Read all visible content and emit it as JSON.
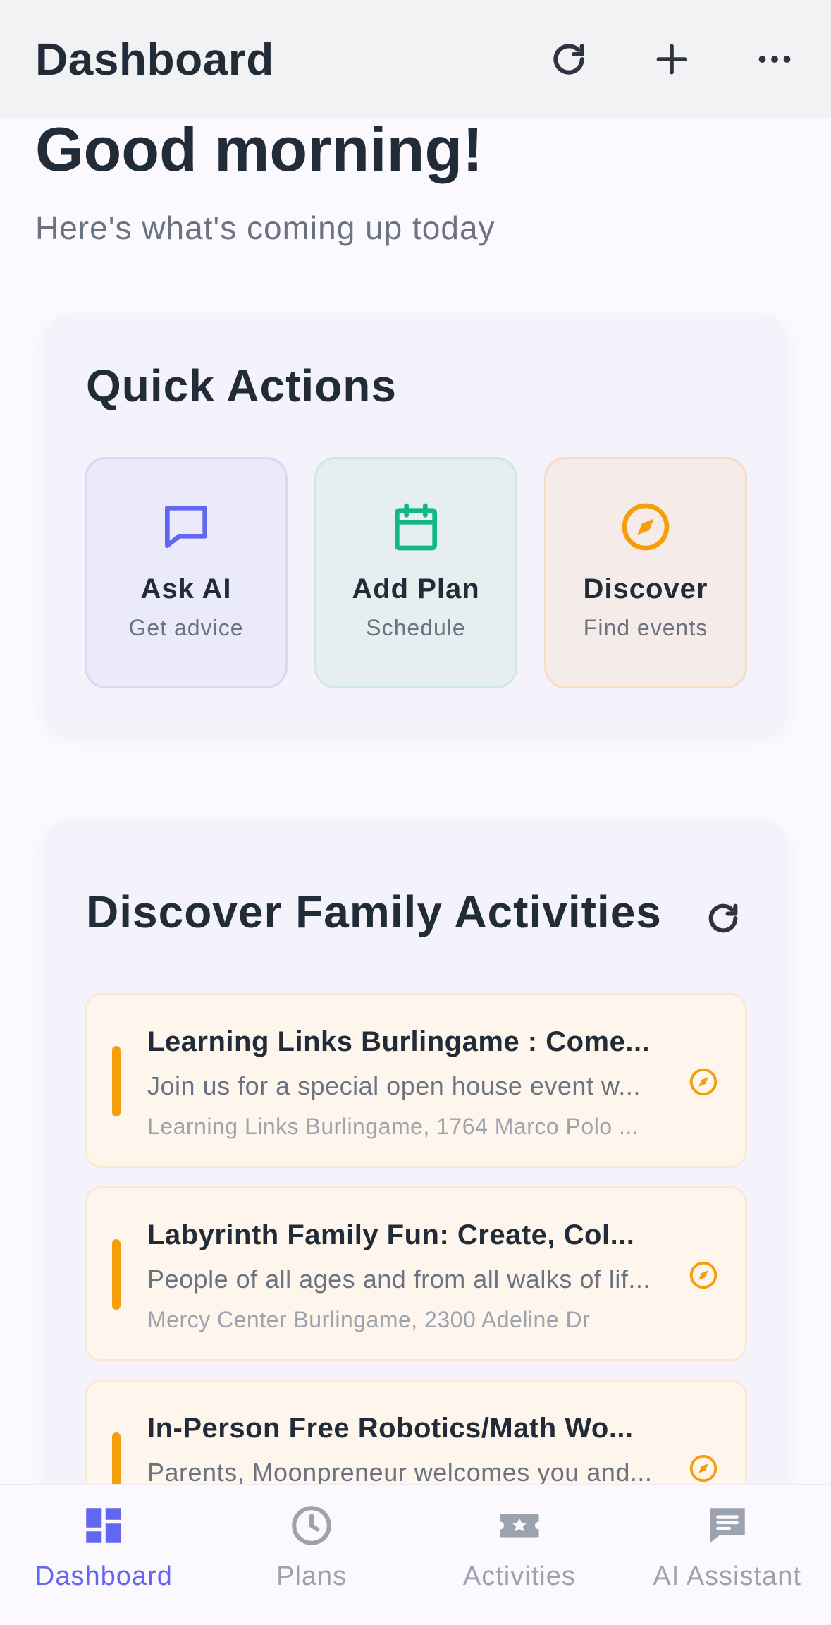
{
  "header": {
    "title": "Dashboard",
    "icons": [
      "refresh-icon",
      "plus-icon",
      "more-icon"
    ]
  },
  "greeting": {
    "title": "Good morning!",
    "subtitle": "Here's what's coming up today"
  },
  "quick_actions": {
    "title": "Quick Actions",
    "items": [
      {
        "label": "Ask AI",
        "sub": "Get advice",
        "icon": "chat-icon",
        "color": "#6366f1"
      },
      {
        "label": "Add Plan",
        "sub": "Schedule",
        "icon": "calendar-icon",
        "color": "#10b981"
      },
      {
        "label": "Discover",
        "sub": "Find events",
        "icon": "compass-icon",
        "color": "#f59e0b"
      }
    ]
  },
  "discover": {
    "title": "Discover Family Activities",
    "items": [
      {
        "title": "Learning Links Burlingame : Come...",
        "desc": "Join us for a special open house event w...",
        "loc": "Learning Links Burlingame, 1764 Marco Polo ..."
      },
      {
        "title": "Labyrinth Family Fun: Create, Col...",
        "desc": "People of all ages and from all walks of lif...",
        "loc": "Mercy Center Burlingame, 2300 Adeline Dr"
      },
      {
        "title": "In-Person Free Robotics/Math Wo...",
        "desc": "Parents, Moonpreneur welcomes you and...",
        "loc": ""
      }
    ]
  },
  "tabs": [
    {
      "label": "Dashboard",
      "icon": "dashboard-icon",
      "active": true
    },
    {
      "label": "Plans",
      "icon": "clock-icon",
      "active": false
    },
    {
      "label": "Activities",
      "icon": "ticket-icon",
      "active": false
    },
    {
      "label": "AI Assistant",
      "icon": "message-icon",
      "active": false
    }
  ],
  "colors": {
    "accent": "#6366f1",
    "text": "#222b38",
    "muted": "#6b7280",
    "orange": "#f59e0b",
    "green": "#10b981"
  }
}
